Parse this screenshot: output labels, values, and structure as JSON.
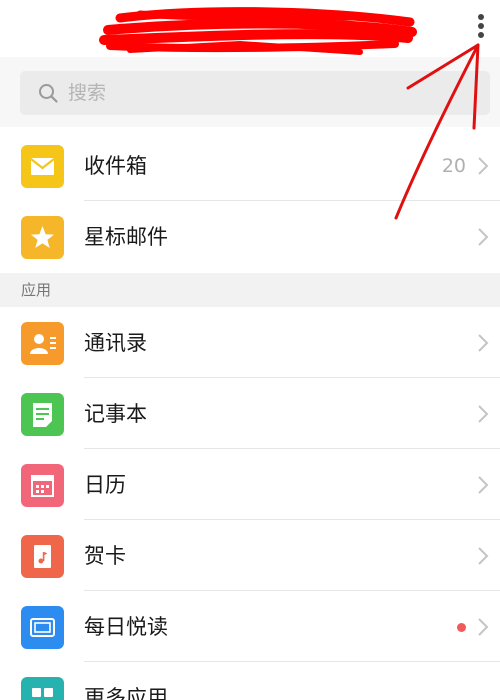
{
  "header": {
    "more_menu_icon": "vertical-ellipsis-icon"
  },
  "search": {
    "placeholder": "搜索",
    "icon": "search-icon"
  },
  "mailbox": [
    {
      "label": "收件箱",
      "count": "20",
      "icon": "inbox-envelope-icon",
      "color": "#f5c518"
    },
    {
      "label": "星标邮件",
      "count": "",
      "icon": "star-icon",
      "color": "#f6b62a"
    }
  ],
  "apps_section": {
    "title": "应用",
    "items": [
      {
        "label": "通讯录",
        "icon": "contacts-icon",
        "color": "#f59a2b"
      },
      {
        "label": "记事本",
        "icon": "notepad-icon",
        "color": "#4cc552"
      },
      {
        "label": "日历",
        "icon": "calendar-icon",
        "color": "#f2667a"
      },
      {
        "label": "贺卡",
        "icon": "greeting-card-icon",
        "color": "#f0664a"
      },
      {
        "label": "每日悦读",
        "icon": "daily-reading-icon",
        "color": "#2d8cf0",
        "has_new_dot": true
      },
      {
        "label": "更多应用",
        "icon": "more-apps-icon",
        "color": "#26b3b0"
      }
    ]
  },
  "annotation": {
    "redaction_color": "#ff0000",
    "arrow_color": "#e01010"
  }
}
